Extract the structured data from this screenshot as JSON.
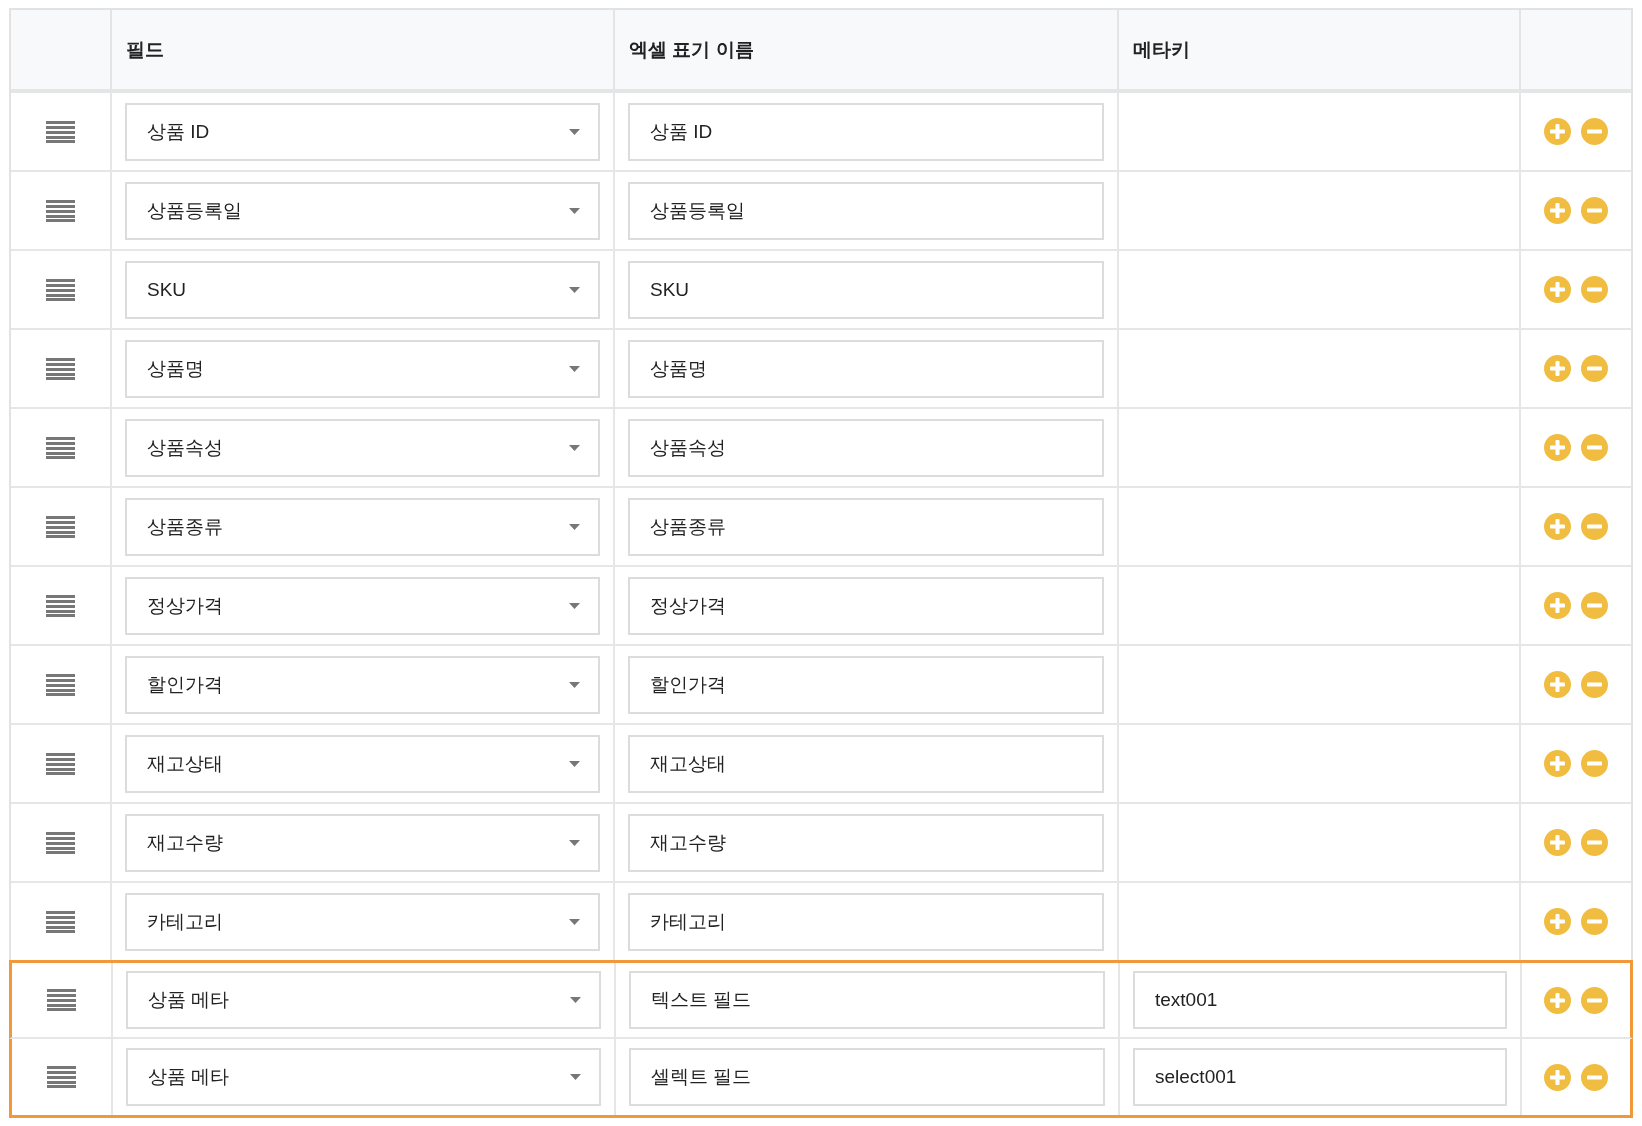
{
  "table": {
    "columns": [
      {},
      {
        "label": "필드"
      },
      {
        "label": "엑셀 표기 이름"
      },
      {
        "label": "메타키"
      },
      {}
    ],
    "rows": [
      {
        "field": "상품 ID",
        "excel_name": "상품 ID",
        "highlighted": false
      },
      {
        "field": "상품등록일",
        "excel_name": "상품등록일",
        "highlighted": false
      },
      {
        "field": "SKU",
        "excel_name": "SKU",
        "highlighted": false
      },
      {
        "field": "상품명",
        "excel_name": "상품명",
        "highlighted": false
      },
      {
        "field": "상품속성",
        "excel_name": "상품속성",
        "highlighted": false
      },
      {
        "field": "상품종류",
        "excel_name": "상품종류",
        "highlighted": false
      },
      {
        "field": "정상가격",
        "excel_name": "정상가격",
        "highlighted": false
      },
      {
        "field": "할인가격",
        "excel_name": "할인가격",
        "highlighted": false
      },
      {
        "field": "재고상태",
        "excel_name": "재고상태",
        "highlighted": false
      },
      {
        "field": "재고수량",
        "excel_name": "재고수량",
        "highlighted": false
      },
      {
        "field": "카테고리",
        "excel_name": "카테고리",
        "highlighted": false
      },
      {
        "field": "상품 메타",
        "excel_name": "텍스트 필드",
        "meta_key": "text001",
        "highlighted": true
      },
      {
        "field": "상품 메타",
        "excel_name": "셀렉트 필드",
        "meta_key": "select001",
        "highlighted": true
      }
    ]
  }
}
